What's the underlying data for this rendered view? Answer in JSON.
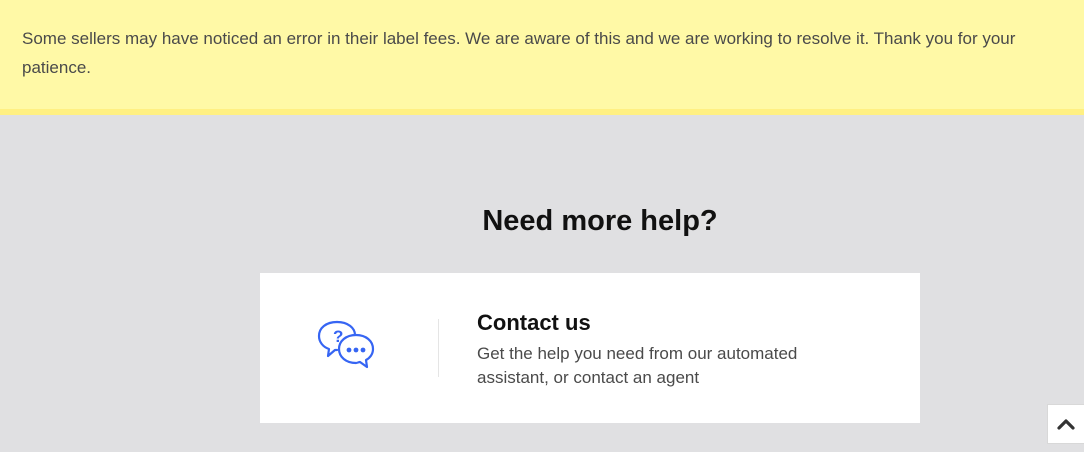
{
  "notice": {
    "message": "Some sellers may have noticed an error in their label fees. We are aware of this and we are working to resolve it. Thank you for your patience."
  },
  "help": {
    "heading": "Need more help?"
  },
  "contact_card": {
    "icon": "chat-bubbles-question-icon",
    "title": "Contact us",
    "description": "Get the help you need from our automated assistant, or contact an agent"
  },
  "back_to_top": {
    "icon": "chevron-up-icon"
  },
  "colors": {
    "notice_background": "#fff9a6",
    "notice_border": "#fff082",
    "page_background": "#e0e0e2",
    "icon_blue": "#3665f3",
    "text_dark": "#111111",
    "text_body": "#4a4a4a"
  }
}
